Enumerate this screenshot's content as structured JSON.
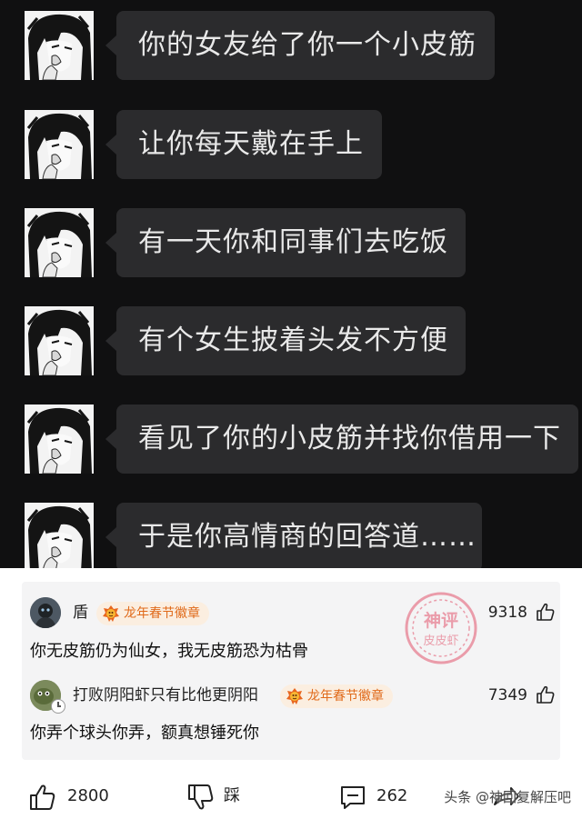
{
  "chat": {
    "messages": [
      "你的女友给了你一个小皮筋",
      "让你每天戴在手上",
      "有一天你和同事们去吃饭",
      "有个女生披着头发不方便",
      "看见了你的小皮筋并找你借用一下",
      "于是你高情商的回答道……"
    ]
  },
  "comments": [
    {
      "username": "盾",
      "badge": "龙年春节徽章",
      "likes": "9318",
      "text": "你无皮筋仍为仙女，我无皮筋恐为枯骨"
    },
    {
      "username": "打败阴阳虾只有比他更阴阳",
      "badge": "龙年春节徽章",
      "likes": "7349",
      "text": "你弄个球头你弄，额真想锤死你"
    }
  ],
  "stamp": {
    "line1": "神评",
    "line2": "皮皮虾"
  },
  "bottom_bar": {
    "like_count": "2800",
    "dislike_label": "踩",
    "comment_count": "262"
  },
  "watermark": "头条 @神回复解压吧",
  "colors": {
    "chat_background": "#101011",
    "bubble": "#2b2b2d",
    "badge_text": "#e06a1a",
    "stamp": "#e2566e"
  }
}
